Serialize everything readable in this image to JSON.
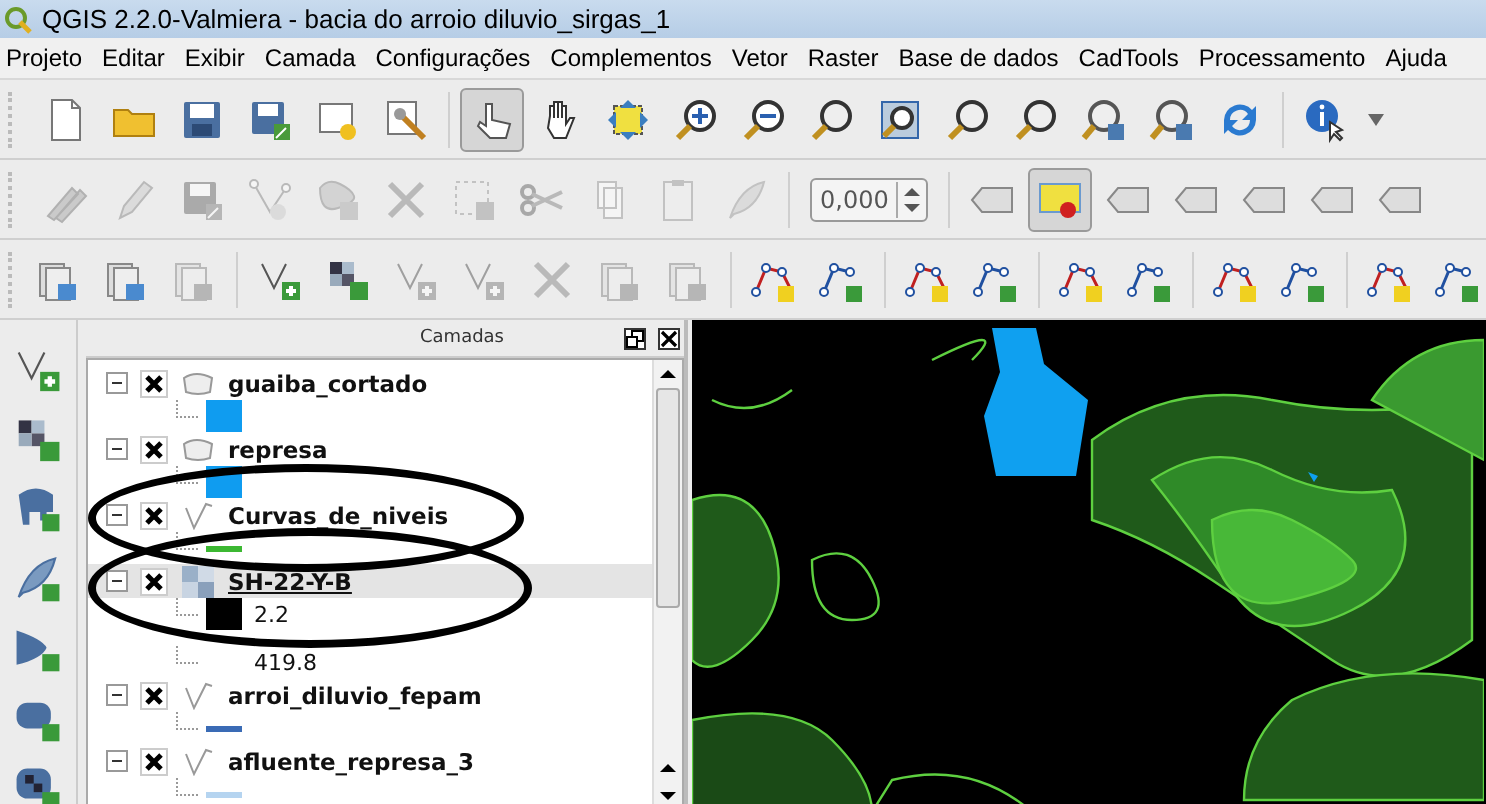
{
  "window": {
    "title": "QGIS 2.2.0-Valmiera - bacia do arroio diluvio_sirgas_1"
  },
  "menu": [
    "Projeto",
    "Editar",
    "Exibir",
    "Camada",
    "Configurações",
    "Complementos",
    "Vetor",
    "Raster",
    "Base de dados",
    "CadTools",
    "Processamento",
    "Ajuda"
  ],
  "toolbars": [
    {
      "buttons": [
        {
          "kind": "tool",
          "selected": false,
          "disabled": false
        },
        {
          "kind": "tool",
          "selected": false,
          "disabled": false
        },
        {
          "kind": "tool",
          "selected": false,
          "disabled": false
        },
        {
          "kind": "tool",
          "selected": false,
          "disabled": false
        },
        {
          "kind": "tool",
          "selected": false,
          "disabled": false
        },
        {
          "kind": "tool",
          "selected": false,
          "disabled": false
        },
        {
          "kind": "tool",
          "selected": true,
          "disabled": false
        },
        {
          "kind": "tool",
          "selected": false,
          "disabled": false
        },
        {
          "kind": "tool",
          "selected": false,
          "disabled": false
        },
        {
          "kind": "tool",
          "selected": false,
          "disabled": false
        },
        {
          "kind": "tool",
          "selected": false,
          "disabled": false
        },
        {
          "kind": "tool",
          "selected": false,
          "disabled": false
        },
        {
          "kind": "tool",
          "selected": false,
          "disabled": false
        },
        {
          "kind": "tool",
          "selected": false,
          "disabled": false
        },
        {
          "kind": "tool",
          "selected": false,
          "disabled": false
        },
        {
          "kind": "tool",
          "selected": false,
          "disabled": false
        },
        {
          "kind": "tool",
          "selected": false,
          "disabled": false
        },
        {
          "kind": "tool",
          "selected": false,
          "disabled": false
        },
        {
          "kind": "tool",
          "selected": false,
          "disabled": false
        }
      ]
    },
    {
      "buttons": [
        {
          "kind": "tool",
          "selected": false,
          "disabled": true
        },
        {
          "kind": "tool",
          "selected": false,
          "disabled": true
        },
        {
          "kind": "tool",
          "selected": false,
          "disabled": true
        },
        {
          "kind": "tool",
          "selected": false,
          "disabled": true
        },
        {
          "kind": "tool",
          "selected": false,
          "disabled": true
        },
        {
          "kind": "tool",
          "selected": false,
          "disabled": true
        },
        {
          "kind": "tool",
          "selected": false,
          "disabled": true
        },
        {
          "kind": "tool",
          "selected": false,
          "disabled": true
        },
        {
          "kind": "tool",
          "selected": false,
          "disabled": true
        },
        {
          "kind": "tool",
          "selected": false,
          "disabled": true
        },
        {
          "kind": "tool",
          "selected": false,
          "disabled": true
        },
        {
          "kind": "spinbox",
          "value": "0,000",
          "disabled": true
        },
        {
          "kind": "tool",
          "selected": false,
          "disabled": false
        },
        {
          "kind": "tool",
          "selected": true,
          "disabled": false
        },
        {
          "kind": "tool",
          "selected": false,
          "disabled": false
        },
        {
          "kind": "tool",
          "selected": false,
          "disabled": false
        },
        {
          "kind": "tool",
          "selected": false,
          "disabled": false
        },
        {
          "kind": "tool",
          "selected": false,
          "disabled": false
        },
        {
          "kind": "tool",
          "selected": false,
          "disabled": false
        }
      ]
    },
    {
      "buttons": [
        {
          "kind": "tool",
          "selected": false,
          "disabled": false
        },
        {
          "kind": "tool",
          "selected": false,
          "disabled": false
        },
        {
          "kind": "tool",
          "selected": false,
          "disabled": true
        },
        {
          "kind": "tool",
          "selected": false,
          "disabled": false
        },
        {
          "kind": "tool",
          "selected": false,
          "disabled": false
        },
        {
          "kind": "tool",
          "selected": false,
          "disabled": true
        },
        {
          "kind": "tool",
          "selected": false,
          "disabled": true
        },
        {
          "kind": "tool",
          "selected": false,
          "disabled": true
        },
        {
          "kind": "tool",
          "selected": false,
          "disabled": true
        },
        {
          "kind": "tool",
          "selected": false,
          "disabled": true
        },
        {
          "kind": "tool",
          "selected": false,
          "disabled": false
        },
        {
          "kind": "tool",
          "selected": false,
          "disabled": false
        },
        {
          "kind": "tool",
          "selected": false,
          "disabled": false
        },
        {
          "kind": "tool",
          "selected": false,
          "disabled": false
        },
        {
          "kind": "tool",
          "selected": false,
          "disabled": false
        },
        {
          "kind": "tool",
          "selected": false,
          "disabled": false
        },
        {
          "kind": "tool",
          "selected": false,
          "disabled": false
        },
        {
          "kind": "tool",
          "selected": false,
          "disabled": false
        },
        {
          "kind": "tool",
          "selected": false,
          "disabled": false
        },
        {
          "kind": "tool",
          "selected": false,
          "disabled": false
        }
      ]
    }
  ],
  "layers_panel": {
    "title": "Camadas",
    "layers": [
      {
        "name": "guaiba_cortado",
        "kind": "polygon",
        "checked": true,
        "expanded": true,
        "selected": false,
        "legend": [
          {
            "kind": "fill",
            "color": "#0f9cf0"
          }
        ]
      },
      {
        "name": "represa",
        "kind": "polygon",
        "checked": true,
        "expanded": true,
        "selected": false,
        "legend": [
          {
            "kind": "fill",
            "color": "#0f9cf0"
          }
        ]
      },
      {
        "name": "Curvas_de_niveis",
        "kind": "line",
        "checked": true,
        "expanded": true,
        "selected": false,
        "legend": [
          {
            "kind": "line",
            "color": "#3cb832"
          }
        ]
      },
      {
        "name": "SH-22-Y-B",
        "kind": "raster",
        "checked": true,
        "expanded": true,
        "selected": true,
        "legend": [
          {
            "kind": "ramp",
            "color": "#000000",
            "label": "2.2"
          },
          {
            "kind": "ramp_end",
            "label": "419.8"
          }
        ]
      },
      {
        "name": "arroi_diluvio_fepam",
        "kind": "line",
        "checked": true,
        "expanded": true,
        "selected": false,
        "legend": [
          {
            "kind": "line",
            "color": "#3a6bb5"
          }
        ]
      },
      {
        "name": "afluente_represa_3",
        "kind": "line",
        "checked": true,
        "expanded": true,
        "selected": false,
        "legend": [
          {
            "kind": "line",
            "color": "#b5d4f0"
          }
        ]
      }
    ]
  }
}
